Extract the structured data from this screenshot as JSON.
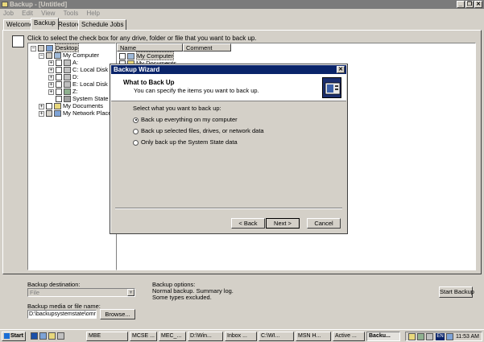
{
  "window": {
    "title": "Backup - [Untitled]",
    "min": "_",
    "restore": "❐",
    "close": "✕"
  },
  "menu": [
    "Job",
    "Edit",
    "View",
    "Tools",
    "Help"
  ],
  "tabs": [
    "Welcome",
    "Backup",
    "Restore",
    "Schedule Jobs"
  ],
  "backup_tab": {
    "instruction": "Click to select the check box for any drive, folder or file that you want to back up.",
    "tree": [
      "Desktop",
      "My Computer",
      "A:",
      "C: Local Disk",
      "D:",
      "E: Local Disk",
      "Z:",
      "System State",
      "My Documents",
      "My Network Places"
    ],
    "list_columns": [
      "Name",
      "Comment"
    ],
    "list_items": [
      "My Computer",
      "My Documents"
    ]
  },
  "wizard": {
    "title": "Backup Wizard",
    "heading": "What to Back Up",
    "subheading": "You can specify the items you want to back up.",
    "prompt": "Select what you want to back up:",
    "options": [
      "Back up everything on my computer",
      "Back up selected files, drives, or network data",
      "Only back up the System State data"
    ],
    "selected_option": 0,
    "back": "< Back",
    "next": "Next >",
    "cancel": "Cancel"
  },
  "bottom": {
    "destination_label": "Backup destination:",
    "destination_value": "File",
    "media_label": "Backup media or file name:",
    "media_value": "D:\\backupsystemstate\\ommax",
    "browse": "Browse...",
    "options_label": "Backup options:",
    "options_line1": "Normal backup.  Summary log.",
    "options_line2": "Some types excluded.",
    "start": "Start Backup"
  },
  "taskbar": {
    "start": "Start",
    "items": [
      "MBE",
      "MCSE ...",
      "MEC_...",
      "D:\\Win...",
      "Inbox ...",
      "C:\\WI...",
      "MSN H...",
      "Active ...",
      "Backu..."
    ],
    "active_index": 8,
    "tray_lang": "EN",
    "clock": "11:53 AM"
  },
  "colors": {
    "titlebar_inactive": "#7b7b7b",
    "dialog_titlebar": "#0a246a",
    "face": "#d4d0c8"
  }
}
